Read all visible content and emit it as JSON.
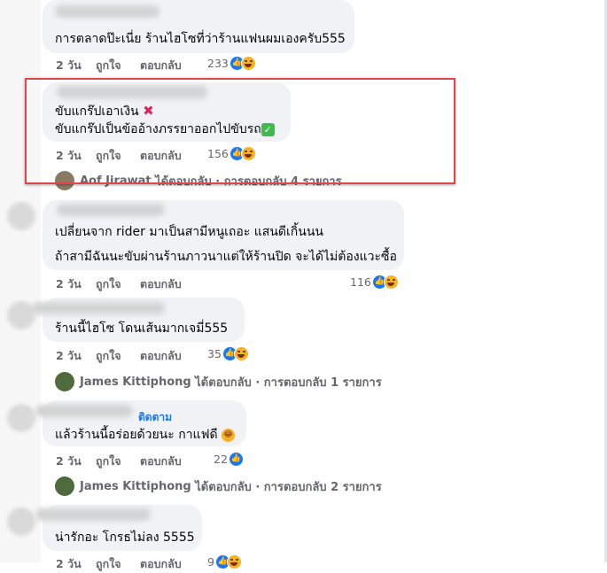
{
  "comments": [
    {
      "text_lines": [
        "การตลาดป๊ะเนี่ย ร้านไฮโซที่ว่าร้านแฟนผมเองครับ555"
      ],
      "time": "2 วัน",
      "like_label": "ถูกใจ",
      "reply_label": "ตอบกลับ",
      "reaction_count": "233",
      "reactions": [
        "like-icon",
        "haha-icon"
      ]
    },
    {
      "text_lines": [
        "ขับแกร๊ปเอาเงิน",
        "ขับแกร๊ปเป็นข้ออ้างภรรยาออกไปขับรถ"
      ],
      "line_emojis": [
        "cross-mark-icon",
        "check-mark-icon"
      ],
      "time": "2 วัน",
      "like_label": "ถูกใจ",
      "reply_label": "ตอบกลับ",
      "reaction_count": "156",
      "reactions": [
        "like-icon",
        "haha-icon"
      ],
      "reply_summary": {
        "name": "Aof Jirawat",
        "text": "ได้ตอบกลับ · การตอบกลับ 4 รายการ"
      }
    },
    {
      "text_lines": [
        "เปลี่ยนจาก rider มาเป็นสามีหนูเถอะ แสนดีเกิ้นนน",
        "ถ้าสามีฉันนะขับผ่านร้านภาวนาแต่ให้ร้านปิด จะได้ไม่ต้องแวะซื้อ"
      ],
      "time": "2 วัน",
      "like_label": "ถูกใจ",
      "reply_label": "ตอบกลับ",
      "reaction_count": "116",
      "reactions": [
        "like-icon",
        "haha-icon"
      ]
    },
    {
      "text_lines": [
        "ร้านนี้ไฮโซ โดนเส้นมากเจมี่555"
      ],
      "time": "2 วัน",
      "like_label": "ถูกใจ",
      "reply_label": "ตอบกลับ",
      "reaction_count": "35",
      "reactions": [
        "like-icon",
        "haha-icon"
      ],
      "reply_summary": {
        "name": "James Kittiphong",
        "text": "ได้ตอบกลับ · การตอบกลับ 1 รายการ"
      }
    },
    {
      "follow_label": "ติดตาม",
      "text_lines": [
        "แล้วร้านนี้อร่อยด้วยนะ กาแฟดี"
      ],
      "line_emojis": [
        "laughing-emoji-icon"
      ],
      "time": "2 วัน",
      "like_label": "ถูกใจ",
      "reply_label": "ตอบกลับ",
      "reaction_count": "22",
      "reactions": [
        "like-icon"
      ],
      "reply_summary": {
        "name": "James Kittiphong",
        "text": "ได้ตอบกลับ · การตอบกลับ 2 รายการ"
      }
    },
    {
      "text_lines": [
        "น่ารักอะ โกรธไม่ลง 5555"
      ],
      "time": "2 วัน",
      "like_label": "ถูกใจ",
      "reply_label": "ตอบกลับ",
      "reaction_count": "9",
      "reactions": [
        "like-icon",
        "haha-icon"
      ]
    }
  ],
  "colors": {
    "highlight_border": "#e0474c",
    "bubble": "#f0f2f5",
    "link": "#1877f2",
    "meta_text": "#65676b"
  }
}
